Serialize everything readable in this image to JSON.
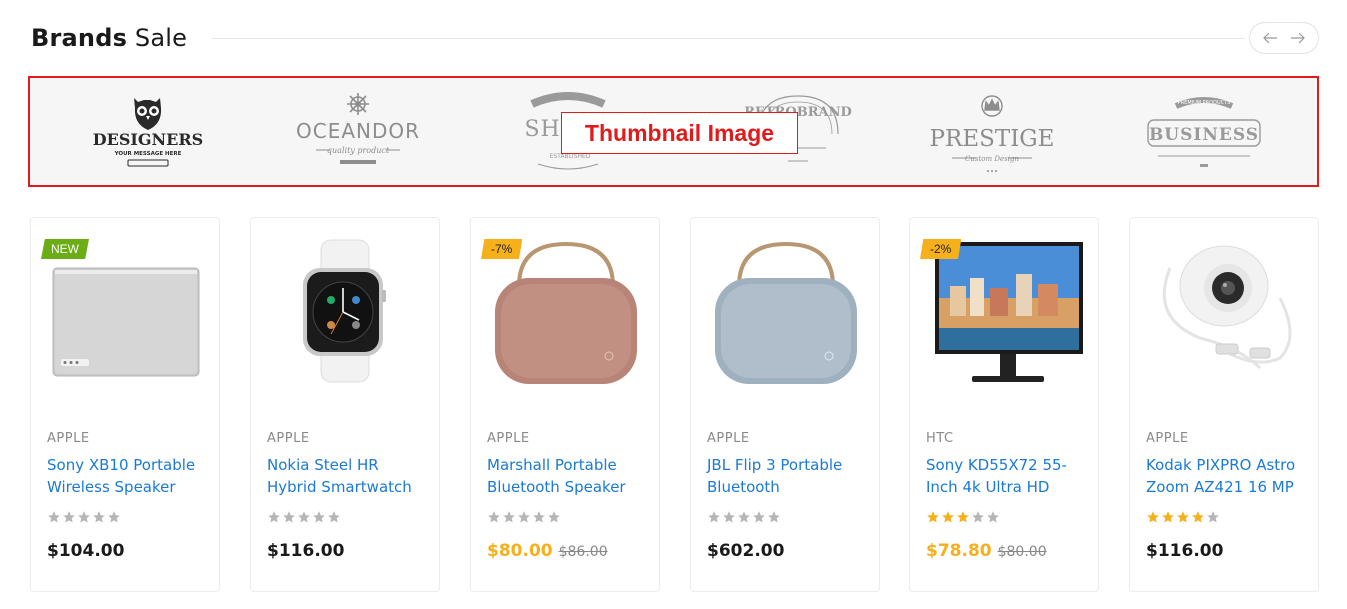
{
  "header": {
    "title_bold": "Brands",
    "title_light": "Sale",
    "prev_icon": "arrow-left-icon",
    "next_icon": "arrow-right-icon"
  },
  "brands": {
    "thumbnail_label": "Thumbnail Image",
    "logos": [
      {
        "name": "DESIGNERS",
        "tagline": "YOUR MESSAGE HERE",
        "icon": "owl-icon"
      },
      {
        "name": "OCEANDOR",
        "tagline": "quality product",
        "icon": "ship-wheel-icon"
      },
      {
        "name": "SHOP",
        "tagline": "ESTABLISHED",
        "icon": "ribbon-badge-icon"
      },
      {
        "name": "RETROBRAND",
        "tagline": "",
        "icon": "arc-badge-icon"
      },
      {
        "name": "PRESTIGE",
        "tagline": "Custom Design",
        "icon": "crown-icon"
      },
      {
        "name": "BUSINESS",
        "tagline": "PREMIUM PRODUCTS",
        "icon": "ribbon-badge-icon"
      }
    ]
  },
  "colors": {
    "accent_link": "#1a7ad4",
    "sale": "#f5b01b",
    "new_badge": "#6cac15",
    "highlight_border": "#e11b1b"
  },
  "products": [
    {
      "brand": "APPLE",
      "name": "Sony XB10 Portable Wireless Speaker",
      "rating": 0,
      "price": "$104.00",
      "old_price": "",
      "badge": "NEW",
      "image": "speaker-grey-icon"
    },
    {
      "brand": "APPLE",
      "name": "Nokia Steel HR Hybrid Smartwatch",
      "rating": 0,
      "price": "$116.00",
      "old_price": "",
      "badge": "",
      "image": "smartwatch-icon"
    },
    {
      "brand": "APPLE",
      "name": "Marshall Portable Bluetooth Speaker",
      "rating": 0,
      "price": "$80.00",
      "old_price": "$86.00",
      "badge": "-7%",
      "image": "speaker-rose-icon"
    },
    {
      "brand": "APPLE",
      "name": "JBL Flip 3 Portable Bluetooth",
      "rating": 0,
      "price": "$602.00",
      "old_price": "",
      "badge": "",
      "image": "speaker-blue-icon"
    },
    {
      "brand": "HTC",
      "name": "Sony KD55X72 55-Inch 4k Ultra HD",
      "rating": 3,
      "price": "$78.80",
      "old_price": "$80.00",
      "badge": "-2%",
      "image": "monitor-icon"
    },
    {
      "brand": "APPLE",
      "name": "Kodak PIXPRO Astro Zoom AZ421 16 MP",
      "rating": 4,
      "price": "$116.00",
      "old_price": "",
      "badge": "",
      "image": "dome-camera-icon"
    }
  ]
}
